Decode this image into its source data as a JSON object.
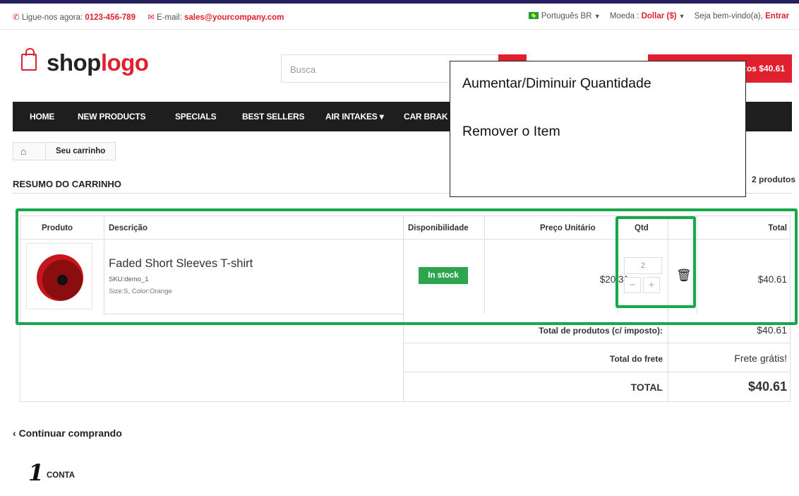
{
  "topbar": {
    "phone_label": "Ligue-nos agora:",
    "phone": "0123-456-789",
    "email_label": "E-mail:",
    "email": "sales@yourcompany.com",
    "language": "Português BR",
    "currency_label": "Moeda :",
    "currency": "Dollar ($)",
    "welcome": "Seja bem-vindo(a),",
    "login": "Entrar"
  },
  "logo": {
    "part1": "shop",
    "part2": "logo"
  },
  "search": {
    "placeholder": "Busca"
  },
  "cart_button": {
    "label": "tos $40.61"
  },
  "nav": [
    "HOME",
    "NEW PRODUCTS",
    "SPECIALS",
    "BEST SELLERS",
    "AIR INTAKES ▾",
    "CAR BRAK"
  ],
  "breadcrumb": {
    "current": "Seu carrinho"
  },
  "summary": {
    "title": "RESUMO DO CARRINHO",
    "count": "2 produtos"
  },
  "table": {
    "headers": {
      "product": "Produto",
      "description": "Descrição",
      "availability": "Disponibilidade",
      "unit_price": "Preço Unitário",
      "qty": "Qtd",
      "total": "Total"
    },
    "item": {
      "name": "Faded Short Sleeves T-shirt",
      "sku": "SKU:demo_1",
      "attributes": "Size:S, Color:Orange",
      "availability": "In stock",
      "unit_price": "$20.31",
      "qty": "2",
      "total": "$40.61"
    },
    "totals": {
      "products_label": "Total de produtos (c/ imposto):",
      "products_value": "$40.61",
      "shipping_label": "Total do frete",
      "shipping_value": "Frete grátis!",
      "total_label": "TOTAL",
      "total_value": "$40.61"
    }
  },
  "callout": {
    "line1": "Aumentar/Diminuir Quantidade",
    "line2": "Remover o Item"
  },
  "continue_shopping": "Continuar comprando",
  "step": {
    "number": "1",
    "label": "CONTA"
  },
  "colors": {
    "brand_red": "#e0202e",
    "highlight_green": "#16a84a",
    "stock_green": "#2ea44f",
    "nav_dark": "#1e1e1e"
  },
  "icons": [
    "phone-icon",
    "mail-icon",
    "brazil-flag-icon",
    "home-icon",
    "trash-icon",
    "minus-icon",
    "plus-icon",
    "chevron-left-icon",
    "shopping-bag-icon"
  ]
}
